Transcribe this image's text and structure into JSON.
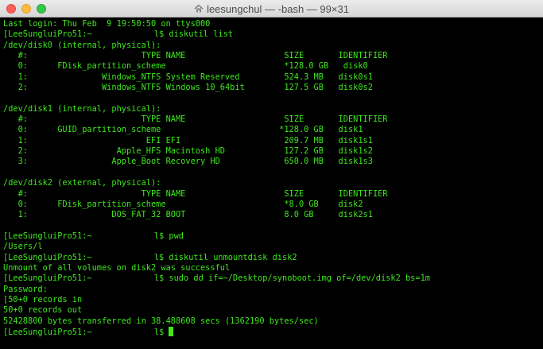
{
  "window": {
    "title": "leesungchul — -bash — 99×31"
  },
  "terminal": {
    "prompt": "[LeeSungluiPro51:~ ",
    "prompt_end": "l$ ",
    "lines": [
      "Last login: Thu Feb  9 19:50:50 on ttys000",
      "__PROMPT__diskutil list",
      "/dev/disk0 (internal, physical):",
      "   #:                       TYPE NAME                    SIZE       IDENTIFIER",
      "   0:      FDisk_partition_scheme                        *128.0 GB   disk0",
      "   1:               Windows_NTFS System Reserved         524.3 MB   disk0s1",
      "   2:               Windows_NTFS Windows 10_64bit        127.5 GB   disk0s2",
      "",
      "/dev/disk1 (internal, physical):",
      "   #:                       TYPE NAME                    SIZE       IDENTIFIER",
      "   0:      GUID_partition_scheme                        *128.0 GB   disk1",
      "   1:                        EFI EFI                     209.7 MB   disk1s1",
      "   2:                  Apple_HFS Macintosh HD            127.2 GB   disk1s2",
      "   3:                 Apple_Boot Recovery HD             650.0 MB   disk1s3",
      "",
      "/dev/disk2 (external, physical):",
      "   #:                       TYPE NAME                    SIZE       IDENTIFIER",
      "   0:      FDisk_partition_scheme                        *8.0 GB    disk2",
      "   1:                 DOS_FAT_32 BOOT                    8.0 GB     disk2s1",
      "",
      "__PROMPT__pwd",
      "/Users/l",
      "__PROMPT__diskutil unmountdisk disk2",
      "Unmount of all volumes on disk2 was successful",
      "__PROMPT__sudo dd if=~/Desktop/synoboot.img of=/dev/disk2 bs=1m",
      "Password:",
      "[50+0 records in",
      "50+0 records out",
      "52428800 bytes transferred in 38.488608 secs (1362190 bytes/sec)",
      "__PROMPT__"
    ]
  }
}
